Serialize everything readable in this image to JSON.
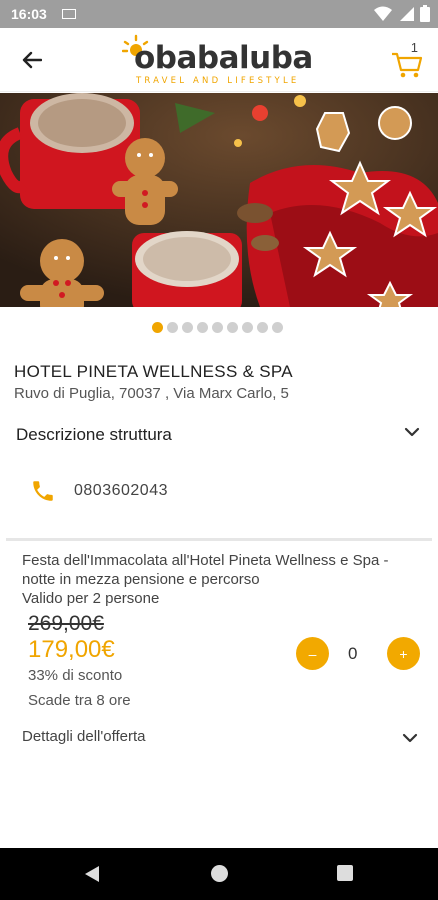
{
  "status_bar": {
    "time": "16:03"
  },
  "header": {
    "logo_name": "obabaluba",
    "logo_tagline": "TRAVEL AND LIFESTYLE",
    "cart_count": "1",
    "brand_color": "#f0a500"
  },
  "carousel": {
    "image": "christmas-gingerbread-cocoa",
    "page_count": 9,
    "active_index": 0
  },
  "hotel": {
    "name": "HOTEL PINETA WELLNESS & SPA",
    "address": "Ruvo di Puglia, 70037 , Via Marx Carlo, 5"
  },
  "description": {
    "label": "Descrizione struttura"
  },
  "contact": {
    "phone": "0803602043"
  },
  "offer": {
    "title": "Festa dell'Immacolata all'Hotel Pineta Wellness e Spa - notte in mezza pensione e percorso",
    "validity": "Valido per 2 persone",
    "old_price": "269,00€",
    "new_price": "179,00€",
    "discount": "33% di sconto",
    "expires": "Scade tra 8 ore",
    "quantity": "0",
    "minus_label": "–",
    "plus_label": "+",
    "details_label": "Dettagli dell'offerta"
  }
}
